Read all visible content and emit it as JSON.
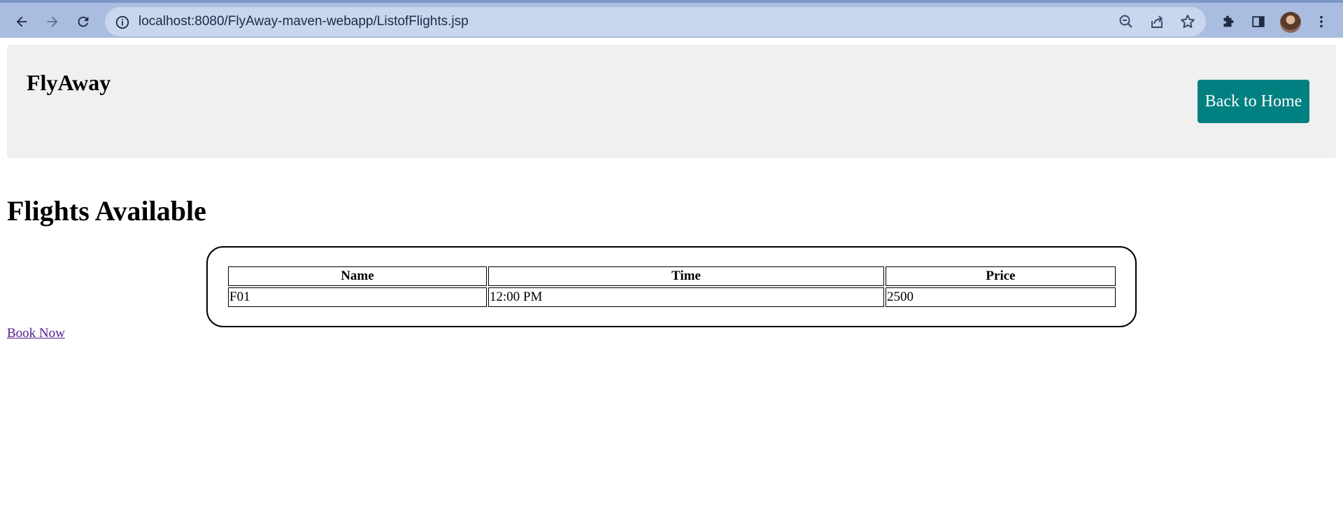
{
  "browser": {
    "url": "localhost:8080/FlyAway-maven-webapp/ListofFlights.jsp",
    "icons": [
      "back-icon",
      "forward-icon",
      "reload-icon",
      "site-info-icon",
      "zoom-out-icon",
      "share-icon",
      "star-icon",
      "extensions-icon",
      "side-panel-icon",
      "avatar",
      "menu-icon"
    ]
  },
  "header": {
    "brand": "FlyAway",
    "home_button": "Back to Home",
    "accent_color": "#008080"
  },
  "main": {
    "title": "Flights Available",
    "table": {
      "columns": [
        "Name",
        "Time",
        "Price"
      ],
      "rows": [
        [
          "F01",
          "12:00 PM",
          "2500"
        ]
      ]
    },
    "book_link": "Book Now"
  }
}
